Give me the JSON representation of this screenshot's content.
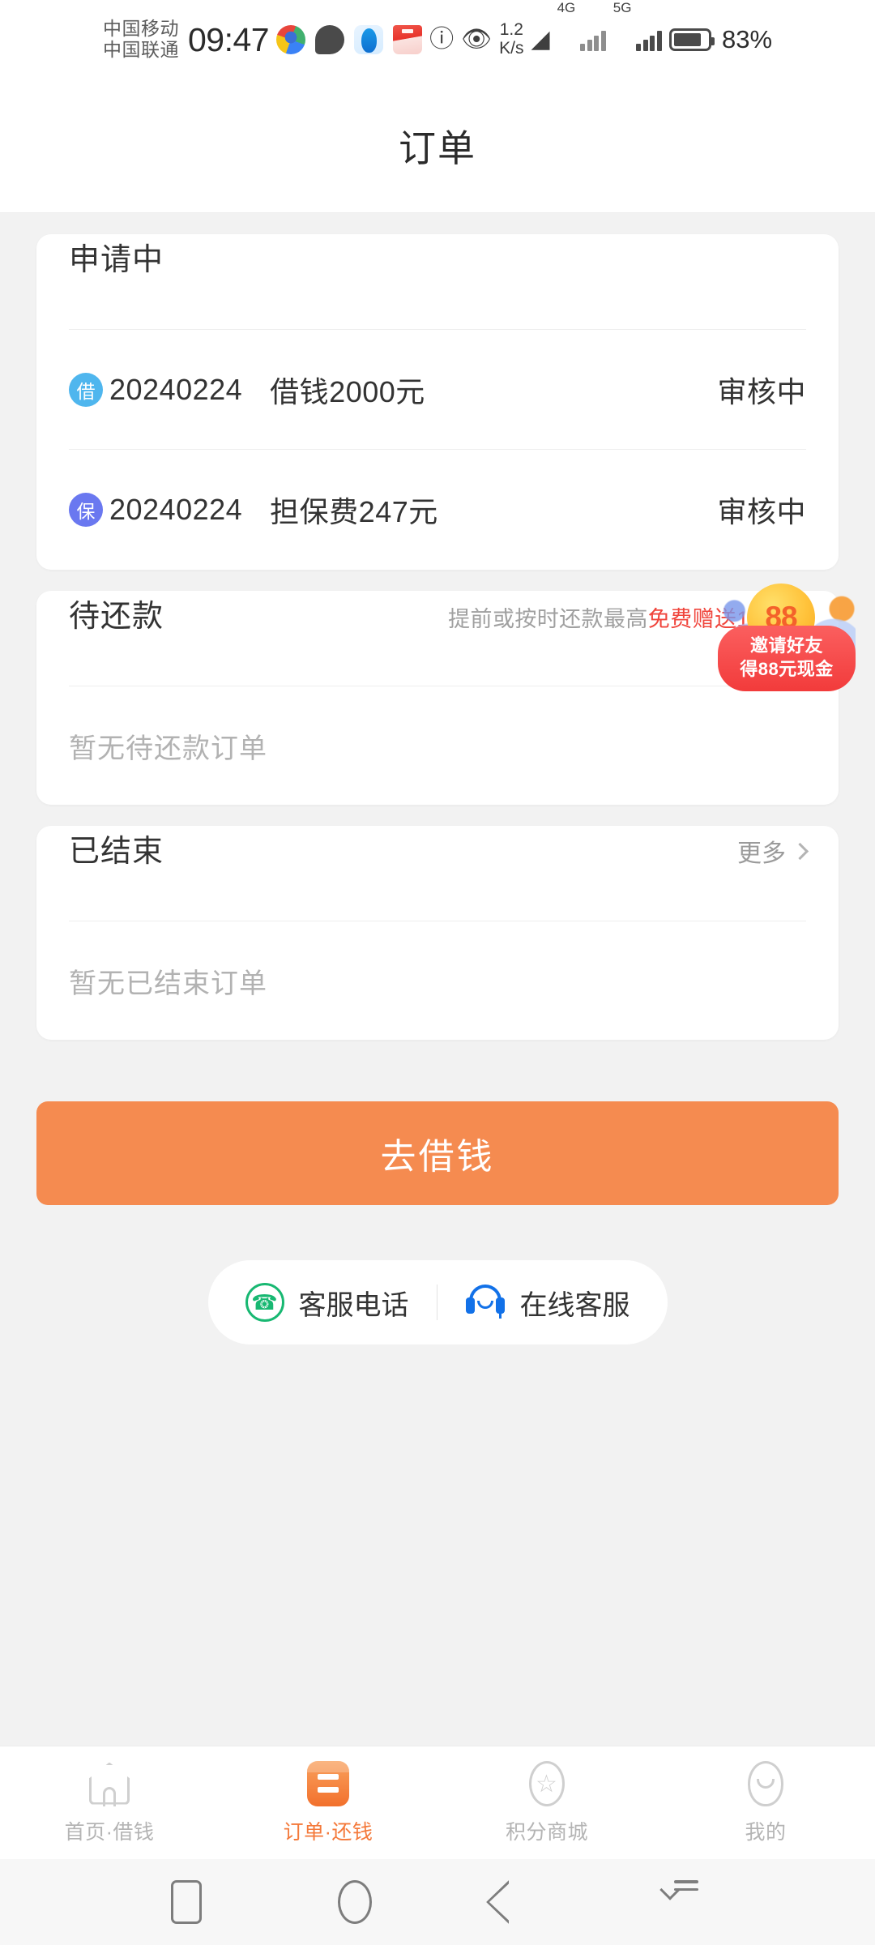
{
  "status_bar": {
    "carrier_primary": "中国移动",
    "carrier_secondary": "中国联通",
    "time": "09:47",
    "net_speed_value": "1.2",
    "net_speed_unit": "K/s",
    "network_4g": "4G",
    "network_5g": "5G",
    "battery_percent": "83%",
    "app_icons": [
      "qq-icon",
      "chat-bubble-icon",
      "browser-icon",
      "red-package-icon",
      "data-sync-icon",
      "eye-icon",
      "wifi-icon"
    ]
  },
  "header": {
    "title": "订单"
  },
  "cards": {
    "applying": {
      "title": "申请中",
      "orders": [
        {
          "badge": "借",
          "badge_type": "borrow",
          "date": "20240224",
          "desc": "借钱2000元",
          "status": "审核中"
        },
        {
          "badge": "保",
          "badge_type": "guarantee",
          "date": "20240224",
          "desc": "担保费247元",
          "status": "审核中"
        }
      ]
    },
    "pending_repay": {
      "title": "待还款",
      "subtitle_normal": "提前或按时还款最高",
      "subtitle_highlight": "免费赠送10积分",
      "empty_text": "暂无待还款订单"
    },
    "finished": {
      "title": "已结束",
      "more_label": "更多",
      "empty_text": "暂无已结束订单"
    }
  },
  "cta": {
    "label": "去借钱"
  },
  "service": {
    "phone_label": "客服电话",
    "online_label": "在线客服"
  },
  "invite_badge": {
    "coin_text": "88",
    "line1": "邀请好友",
    "line2": "得88元现金"
  },
  "tabbar": {
    "items": [
      {
        "label": "首页·借钱",
        "icon": "home-icon",
        "active": false
      },
      {
        "label": "订单·还钱",
        "icon": "order-list-icon",
        "active": true
      },
      {
        "label": "积分商城",
        "icon": "star-icon",
        "active": false
      },
      {
        "label": "我的",
        "icon": "profile-smiley-icon",
        "active": false
      }
    ]
  },
  "android_nav": {
    "recents": "recents-square-icon",
    "home": "home-circle-icon",
    "back": "back-triangle-icon",
    "pulldown": "notification-pulldown-icon"
  },
  "colors": {
    "accent_orange": "#f58b50",
    "tab_active": "#f4793a",
    "highlight_red": "#f0453c",
    "badge_borrow": "#4fb6ee",
    "badge_guarantee": "#6a78f0",
    "page_bg": "#f2f2f2"
  }
}
